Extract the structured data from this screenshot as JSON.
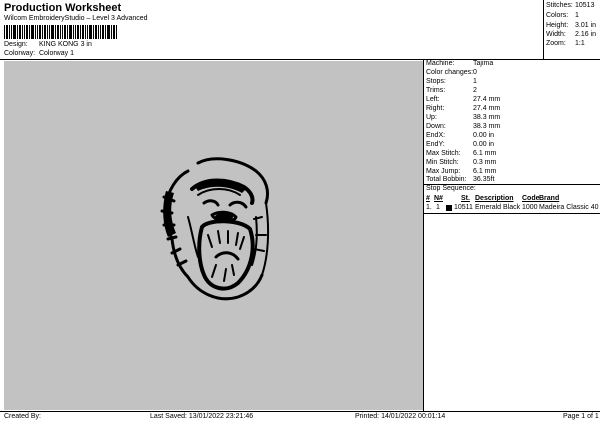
{
  "header": {
    "title": "Production Worksheet",
    "subtitle": "Wilcom EmbroideryStudio – Level 3 Advanced"
  },
  "design": {
    "label": "Design:",
    "value": "KING KONG 3 in"
  },
  "colorway": {
    "label": "Colorway:",
    "value": "Colorway 1"
  },
  "stats": [
    {
      "label": "Stitches:",
      "value": "10513"
    },
    {
      "label": "Colors:",
      "value": "1"
    },
    {
      "label": "Height:",
      "value": "3.01 in"
    },
    {
      "label": "Width:",
      "value": "2.16 in"
    },
    {
      "label": "Zoom:",
      "value": "1:1"
    }
  ],
  "machine_info": [
    {
      "label": "Machine:",
      "value": "Tajima"
    },
    {
      "label": "Color changes:",
      "value": "0"
    },
    {
      "label": "Stops:",
      "value": "1"
    },
    {
      "label": "Trims:",
      "value": "2"
    },
    {
      "label": "Left:",
      "value": "27.4 mm"
    },
    {
      "label": "Right:",
      "value": "27.4 mm"
    },
    {
      "label": "Up:",
      "value": "38.3 mm"
    },
    {
      "label": "Down:",
      "value": "38.3 mm"
    },
    {
      "label": "EndX:",
      "value": "0.00 in"
    },
    {
      "label": "EndY:",
      "value": "0.00 in"
    },
    {
      "label": "Max Stitch:",
      "value": "6.1 mm"
    },
    {
      "label": "Min Stitch:",
      "value": "0.3 mm"
    },
    {
      "label": "Max Jump:",
      "value": "6.1 mm"
    },
    {
      "label": "Total Bobbin:",
      "value": "36.35ft"
    }
  ],
  "stop_sequence": {
    "title": "Stop Sequence:",
    "headers": [
      "#",
      "N#",
      "St.",
      "Description",
      "Code",
      "Brand"
    ],
    "rows": [
      {
        "num": "1.",
        "needle": "1",
        "stitches": "10511",
        "description": "Emerald Black",
        "code": "1000",
        "brand": "Madeira Classic 40",
        "color": "#000000"
      }
    ]
  },
  "footer": {
    "created_by": "Created By:",
    "last_saved": "Last Saved: 13/01/2022 23:21:46",
    "printed": "Printed: 14/01/2022 00:01:14",
    "page": "Page 1 of 1"
  },
  "colors": {
    "canvas": "#c2c2c2"
  }
}
